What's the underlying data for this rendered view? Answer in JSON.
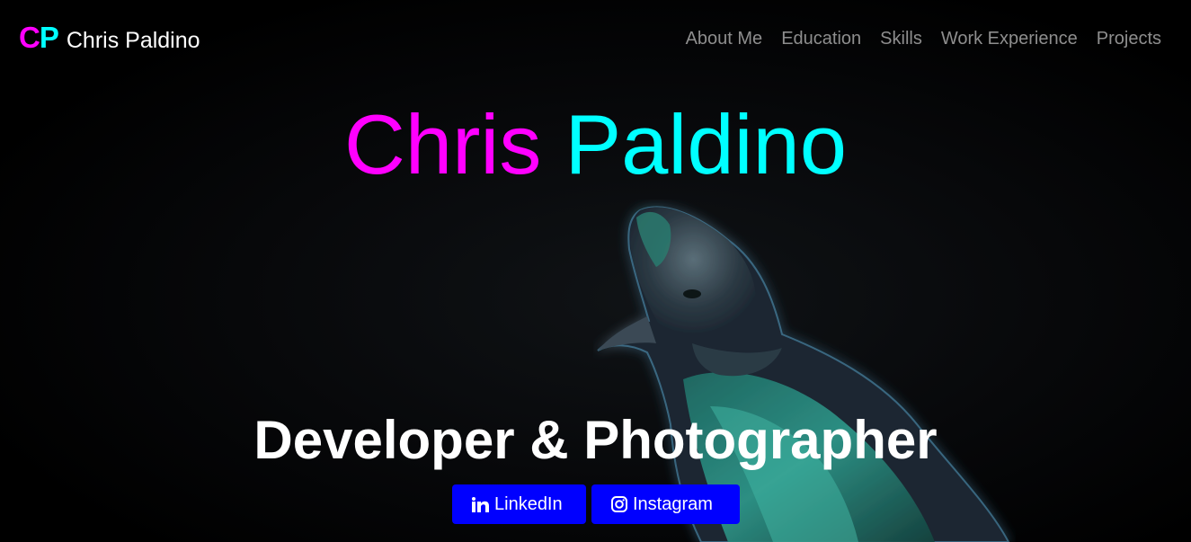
{
  "navbar": {
    "logo": {
      "c": "C",
      "p": "P"
    },
    "brand_name": "Chris Paldino",
    "links": [
      "About Me",
      "Education",
      "Skills",
      "Work Experience",
      "Projects"
    ]
  },
  "hero": {
    "first_name": "Chris",
    "last_name": "Paldino",
    "subtitle": "Developer & Photographer",
    "buttons": {
      "linkedin": {
        "label": "LinkedIn",
        "icon": "linkedin-icon"
      },
      "instagram": {
        "label": "Instagram",
        "icon": "instagram-icon"
      }
    }
  },
  "colors": {
    "magenta": "#ff00ff",
    "cyan": "#00ffff",
    "button_blue": "#0000ff",
    "nav_gray": "#8e8e8e"
  }
}
